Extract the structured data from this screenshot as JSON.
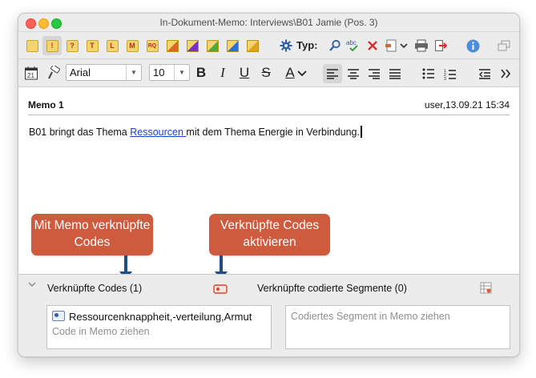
{
  "window": {
    "title": "In-Dokument-Memo: Interviews\\B01 Jamie (Pos. 3)"
  },
  "toolbar1": {
    "memo_icons": [
      "memo-plain-icon",
      "memo-exclamation-icon",
      "memo-question-icon",
      "memo-t-icon",
      "memo-l-icon",
      "memo-m-icon",
      "memo-rq-icon",
      "memo-orange-triangle-icon",
      "memo-purple-triangle-icon",
      "memo-green-triangle-icon",
      "memo-blue-triangle-icon",
      "memo-yellow-triangle-icon"
    ],
    "memo_letters": [
      "",
      "!",
      "?",
      "T",
      "L",
      "M",
      "RQ"
    ],
    "type_label": "Typ:"
  },
  "toolbar2": {
    "font_value": "Arial",
    "size_value": "10",
    "bold": "B",
    "italic": "I",
    "underline": "U",
    "strike": "S",
    "color": "A"
  },
  "memo": {
    "title": "Memo 1",
    "info": "user,13.09.21 15:34",
    "text_before": "B01 bringt das Thema ",
    "text_link": "Ressourcen ",
    "text_after": "mit dem Thema Energie in Verbindung."
  },
  "callouts": {
    "left": "Mit Memo verknüpfte Codes",
    "right": "Verknüpfte Codes aktivieren"
  },
  "bottom": {
    "linked_codes_label": "Verknüpfte Codes (1)",
    "linked_segments_label": "Verknüpfte codierte Segmente (0)",
    "code_item": "Ressourcenknappheit,-verteilung,Armut",
    "code_placeholder": "Code in Memo ziehen",
    "segment_placeholder": "Codiertes Segment in Memo ziehen"
  },
  "colors": {
    "callout": "#cf5b3f",
    "arrow": "#1f4e86",
    "link": "#1f3fcf"
  }
}
